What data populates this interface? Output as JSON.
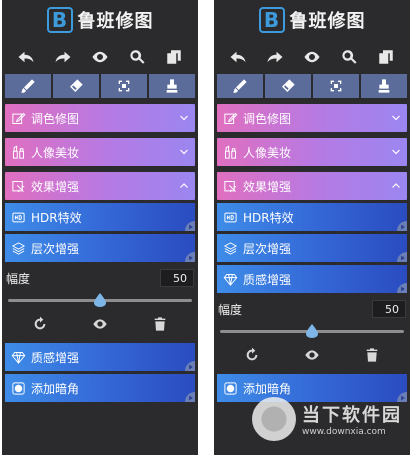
{
  "app_name": "鲁班修图",
  "logo_letter": "B",
  "toolbar_icons": [
    "undo-icon",
    "redo-icon",
    "eye-icon",
    "search-icon",
    "compare-icon"
  ],
  "mode_icons": [
    "brush-icon",
    "eraser-icon",
    "selection-icon",
    "stamp-icon"
  ],
  "colors": {
    "panel_bg": "#2b2b2d",
    "accordion": "#c47ad6",
    "item": "#3466d6",
    "mode_bar": "#5b6c9a"
  },
  "left": {
    "sections": [
      {
        "label": "调色修图",
        "icon": "edit-icon",
        "state": "collapsed"
      },
      {
        "label": "人像美妆",
        "icon": "cosmetics-icon",
        "state": "collapsed"
      },
      {
        "label": "效果增强",
        "icon": "enhance-icon",
        "state": "expanded"
      }
    ],
    "items_top": [
      {
        "label": "HDR特效",
        "icon": "hdr-icon"
      },
      {
        "label": "层次增强",
        "icon": "layers-icon"
      }
    ],
    "slider": {
      "label": "幅度",
      "value": "50",
      "level": 0.5
    },
    "items_bottom": [
      {
        "label": "质感增强",
        "icon": "diamond-icon"
      },
      {
        "label": "添加暗角",
        "icon": "vignette-icon"
      }
    ]
  },
  "right": {
    "sections": [
      {
        "label": "调色修图",
        "icon": "edit-icon",
        "state": "collapsed"
      },
      {
        "label": "人像美妆",
        "icon": "cosmetics-icon",
        "state": "collapsed"
      },
      {
        "label": "效果增强",
        "icon": "enhance-icon",
        "state": "expanded"
      }
    ],
    "items_top": [
      {
        "label": "HDR特效",
        "icon": "hdr-icon"
      },
      {
        "label": "层次增强",
        "icon": "layers-icon"
      },
      {
        "label": "质感增强",
        "icon": "diamond-icon"
      }
    ],
    "slider": {
      "label": "幅度",
      "value": "50",
      "level": 0.5
    },
    "items_bottom": [
      {
        "label": "添加暗角",
        "icon": "vignette-icon"
      }
    ]
  },
  "watermark": {
    "name": "当下软件园",
    "url": "www.downxia.com"
  }
}
